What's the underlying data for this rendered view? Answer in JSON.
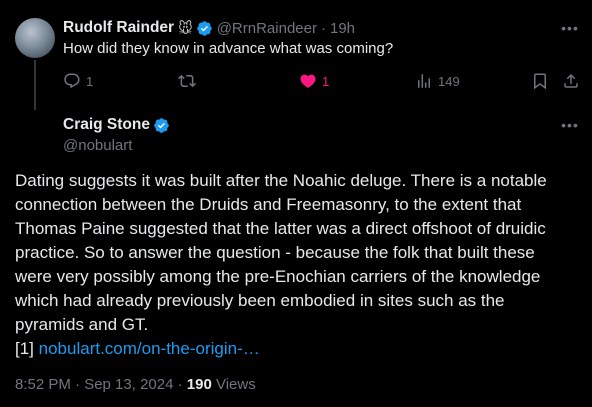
{
  "reply": {
    "display_name": "Rudolf Rainder",
    "emoji": "🐭",
    "handle": "@RrnRaindeer",
    "separator": "·",
    "time": "19h",
    "text": "How did they know in advance what was coming?",
    "actions": {
      "replies": "1",
      "likes": "1",
      "views": "149"
    }
  },
  "main": {
    "display_name": "Craig Stone",
    "handle": "@nobulart",
    "body_lines": [
      "Dating suggests it was built after the Noahic deluge. There is a notable",
      "connection between the Druids and Freemasonry, to the extent that",
      "Thomas Paine suggested that the latter was a direct offshoot of druidic",
      "practice. So to answer the question - because the folk that built these",
      "were very possibly among the pre-Enochian carriers of the knowledge",
      "which had already  previously been embodied in sites such as the",
      "pyramids and GT."
    ],
    "ref_prefix": "[1]",
    "link_text": "nobulart.com/on-the-origin-…",
    "timestamp": "8:52 PM · Sep 13, 2024",
    "meta_separator": "·",
    "views_count": "190",
    "views_label": "Views"
  },
  "colors": {
    "background": "#000000",
    "text": "#e7e9ea",
    "muted": "#71767b",
    "link": "#1d9bf0",
    "verified": "#1d9bf0",
    "like": "#f91880"
  },
  "icons": [
    "verified-badge-icon",
    "more-icon",
    "reply-icon",
    "retweet-icon",
    "heart-icon",
    "views-icon",
    "bookmark-icon",
    "share-icon"
  ]
}
